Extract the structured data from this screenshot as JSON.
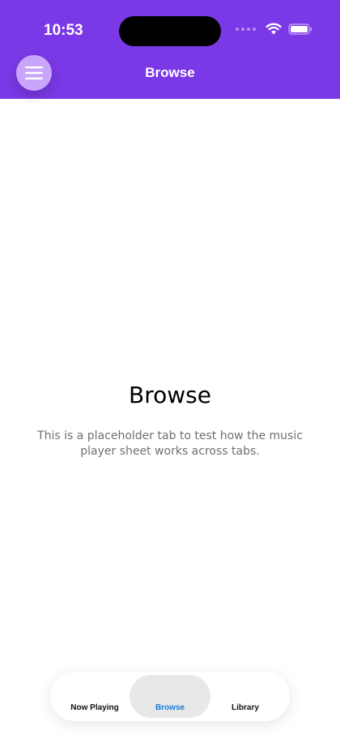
{
  "status_bar": {
    "time": "10:53"
  },
  "header": {
    "title": "Browse",
    "menu_icon": "hamburger-menu-icon",
    "background_color": "#7b38e6"
  },
  "main": {
    "heading": "Browse",
    "description": "This is a placeholder tab to test how the music player sheet works across tabs."
  },
  "tab_bar": {
    "tabs": [
      {
        "label": "Now Playing",
        "selected": false
      },
      {
        "label": "Browse",
        "selected": true
      },
      {
        "label": "Library",
        "selected": false
      }
    ],
    "selected_color": "#1a7bd8"
  }
}
